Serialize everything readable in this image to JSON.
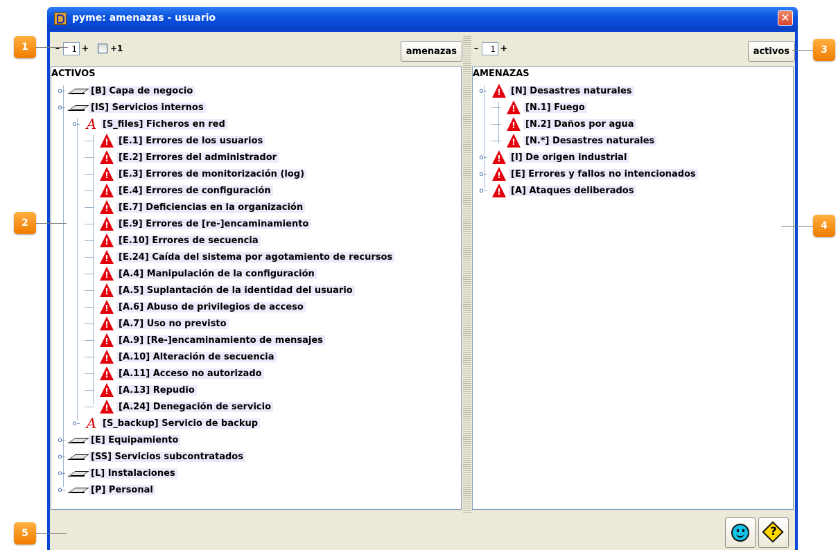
{
  "window": {
    "title": "pyme: amenazas - usuario",
    "close_label": "✕"
  },
  "left_toolbar": {
    "minus": "–",
    "value": "1",
    "plus": "+",
    "checkbox_label": "+1",
    "button_label": "amenazas"
  },
  "right_toolbar": {
    "minus": "–",
    "value": "1",
    "plus": "+",
    "button_label": "activos"
  },
  "left_tree": {
    "root": "ACTIVOS",
    "items": [
      {
        "label": "[B] Capa de negocio",
        "icon": "layer-icon",
        "toggle": "o-"
      },
      {
        "label": "[IS] Servicios internos",
        "icon": "layer-icon",
        "toggle": "o-"
      },
      {
        "label": "[S_files] Ficheros en red",
        "icon": "script-a-icon",
        "toggle": "o-"
      },
      {
        "label": "[E.1] Errores de los usuarios",
        "icon": "warning-icon"
      },
      {
        "label": "[E.2] Errores del administrador",
        "icon": "warning-icon"
      },
      {
        "label": "[E.3] Errores de monitorización (log)",
        "icon": "warning-icon"
      },
      {
        "label": "[E.4] Errores de configuración",
        "icon": "warning-icon"
      },
      {
        "label": "[E.7] Deficiencias en la organización",
        "icon": "warning-icon"
      },
      {
        "label": "[E.9] Errores de [re-]encaminamiento",
        "icon": "warning-icon"
      },
      {
        "label": "[E.10] Errores de secuencia",
        "icon": "warning-icon"
      },
      {
        "label": "[E.24] Caída del sistema por agotamiento de recursos",
        "icon": "warning-icon"
      },
      {
        "label": "[A.4] Manipulación de la configuración",
        "icon": "warning-icon"
      },
      {
        "label": "[A.5] Suplantación de la identidad del usuario",
        "icon": "warning-icon"
      },
      {
        "label": "[A.6] Abuso de privilegios de acceso",
        "icon": "warning-icon"
      },
      {
        "label": "[A.7] Uso no previsto",
        "icon": "warning-icon"
      },
      {
        "label": "[A.9] [Re-]encaminamiento de mensajes",
        "icon": "warning-icon"
      },
      {
        "label": "[A.10] Alteración de secuencia",
        "icon": "warning-icon"
      },
      {
        "label": "[A.11] Acceso no autorizado",
        "icon": "warning-icon"
      },
      {
        "label": "[A.13] Repudio",
        "icon": "warning-icon"
      },
      {
        "label": "[A.24] Denegación de servicio",
        "icon": "warning-icon"
      },
      {
        "label": "[S_backup] Servicio de backup",
        "icon": "script-a-icon",
        "toggle": "o-"
      },
      {
        "label": "[E] Equipamiento",
        "icon": "layer-icon",
        "toggle": "o-"
      },
      {
        "label": "[SS] Servicios subcontratados",
        "icon": "layer-icon",
        "toggle": "o-"
      },
      {
        "label": "[L] Instalaciones",
        "icon": "layer-icon",
        "toggle": "o-"
      },
      {
        "label": "[P] Personal",
        "icon": "layer-icon",
        "toggle": "o-"
      }
    ]
  },
  "right_tree": {
    "root": "AMENAZAS",
    "items": [
      {
        "label": "[N] Desastres naturales",
        "icon": "warning-icon",
        "toggle": "o-"
      },
      {
        "label": "[N.1] Fuego",
        "icon": "warning-icon"
      },
      {
        "label": "[N.2] Daños por agua",
        "icon": "warning-icon"
      },
      {
        "label": "[N.*] Desastres naturales",
        "icon": "warning-icon"
      },
      {
        "label": "[I] De origen industrial",
        "icon": "warning-icon",
        "toggle": "o-"
      },
      {
        "label": "[E] Errores y fallos no intencionados",
        "icon": "warning-icon",
        "toggle": "o-"
      },
      {
        "label": "[A] Ataques deliberados",
        "icon": "warning-icon",
        "toggle": "o-"
      }
    ]
  },
  "callouts": [
    "1",
    "2",
    "3",
    "4",
    "5"
  ],
  "status_icons": [
    "smiley-icon",
    "help-diamond-icon"
  ],
  "colors": {
    "title_bar": "#0a46d6",
    "badge": "#f58a07",
    "selection": "#ebeafa",
    "warning": "#e3000b"
  }
}
